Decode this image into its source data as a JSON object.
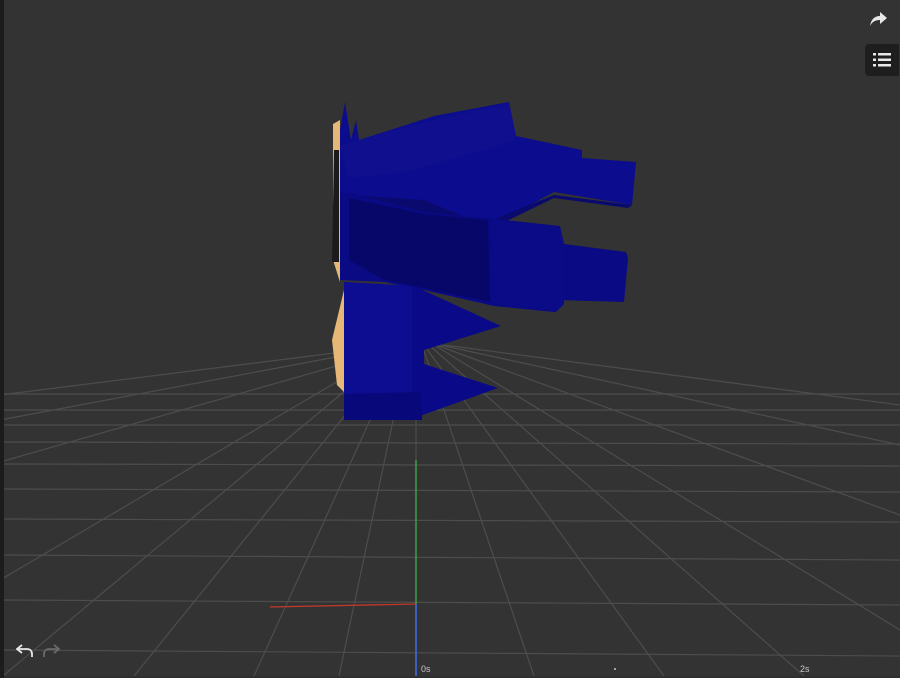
{
  "toolbar": {
    "share_icon": "share-arrow-icon",
    "menu_icon": "list-icon",
    "undo_icon": "undo-icon",
    "redo_icon": "redo-icon"
  },
  "timeline": {
    "start_label": "0s",
    "end_label": "2s"
  },
  "colors": {
    "background": "#333334",
    "grid": "#4d4d4e",
    "model_blue": "#0d0d8c",
    "model_tan": "#e6b878",
    "axis_x": "#c0392b",
    "axis_y": "#3cb043",
    "axis_z": "#3a5fbf"
  }
}
